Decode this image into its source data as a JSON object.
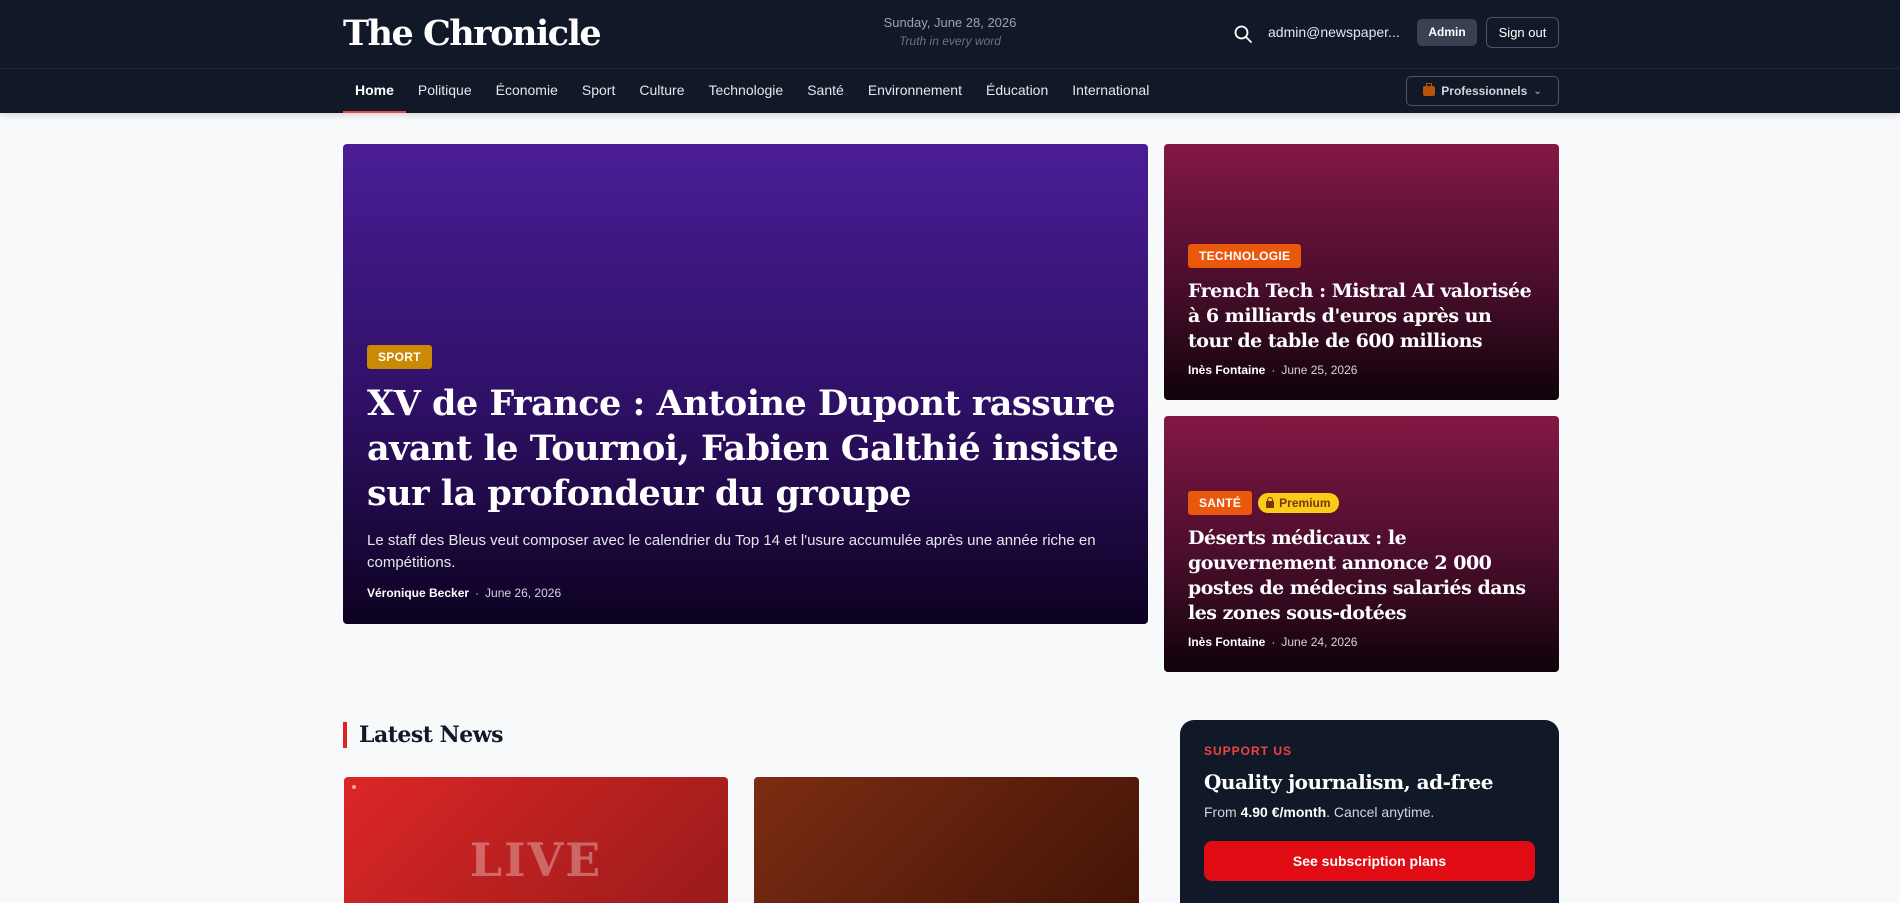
{
  "header": {
    "logo": "The Chronicle",
    "date": "Sunday, June 28, 2026",
    "tagline": "Truth in every word",
    "user_email": "admin@newspaper...",
    "admin_label": "Admin",
    "signout_label": "Sign out"
  },
  "nav": {
    "items": [
      "Home",
      "Politique",
      "Économie",
      "Sport",
      "Culture",
      "Technologie",
      "Santé",
      "Environnement",
      "Éducation",
      "International"
    ],
    "active_index": 0,
    "pro_label": "Professionnels"
  },
  "hero": {
    "main": {
      "category": "SPORT",
      "title": "XV de France : Antoine Dupont rassure avant le Tournoi, Fabien Galthié insiste sur la profondeur du groupe",
      "description": "Le staff des Bleus veut composer avec le calendrier du Top 14 et l'usure accumulée après une année riche en compétitions.",
      "author": "Véronique Becker",
      "date": "June 26, 2026"
    },
    "side": [
      {
        "category": "TECHNOLOGIE",
        "premium": "",
        "title": "French Tech : Mistral AI valorisée à 6 milliards d'euros après un tour de table de 600 millions",
        "author": "Inès Fontaine",
        "date": "June 25, 2026"
      },
      {
        "category": "SANTÉ",
        "premium": "Premium",
        "title": "Déserts médicaux : le gouvernement annonce 2 000 postes de médecins salariés dans les zones sous-dotées",
        "author": "Inès Fontaine",
        "date": "June 24, 2026"
      }
    ]
  },
  "latest": {
    "title": "Latest News",
    "card1_overlay": "LIVE"
  },
  "support": {
    "eyebrow": "SUPPORT US",
    "title": "Quality journalism, ad-free",
    "price_prefix": "From ",
    "price": "4.90 €/month",
    "price_suffix": ". Cancel anytime.",
    "button": "See subscription plans"
  },
  "colors": {
    "header_bg": "#111827",
    "accent": "#dc2626",
    "sport_tag": "#ca8a04",
    "category_tag": "#ea580c",
    "premium_badge": "#facc15"
  }
}
